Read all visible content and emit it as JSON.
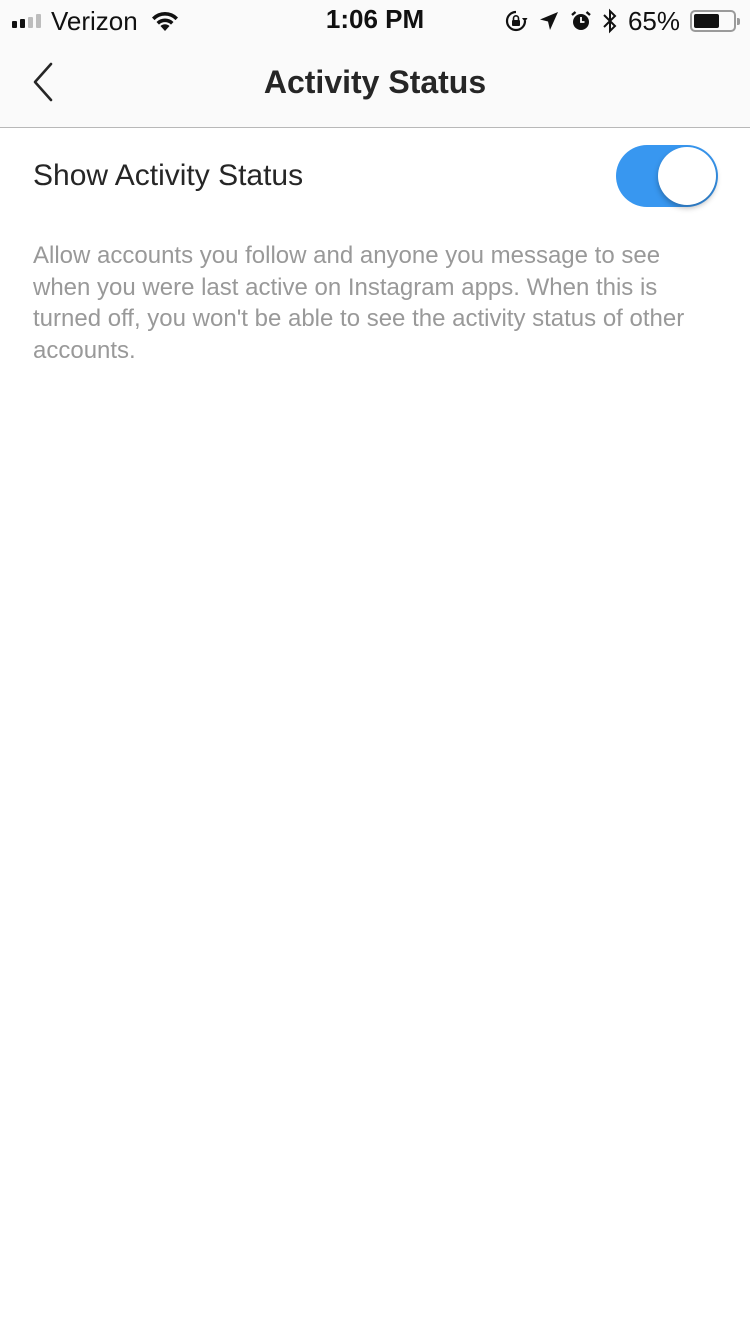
{
  "status_bar": {
    "carrier": "Verizon",
    "signal_bars_active": 2,
    "signal_bars_total": 4,
    "time": "1:06 PM",
    "icons": [
      "orientation-lock-icon",
      "location-arrow-icon",
      "alarm-clock-icon",
      "bluetooth-icon"
    ],
    "battery_percent_label": "65%",
    "battery_level": 0.65
  },
  "nav": {
    "title": "Activity Status",
    "back_icon": "chevron-left-icon"
  },
  "setting": {
    "label": "Show Activity Status",
    "toggle_on": true,
    "toggle_color": "#3897f0",
    "description": "Allow accounts you follow and anyone you message to see when you were last active on Instagram apps. When this is turned off, you won't be able to see the activity status of other accounts."
  }
}
